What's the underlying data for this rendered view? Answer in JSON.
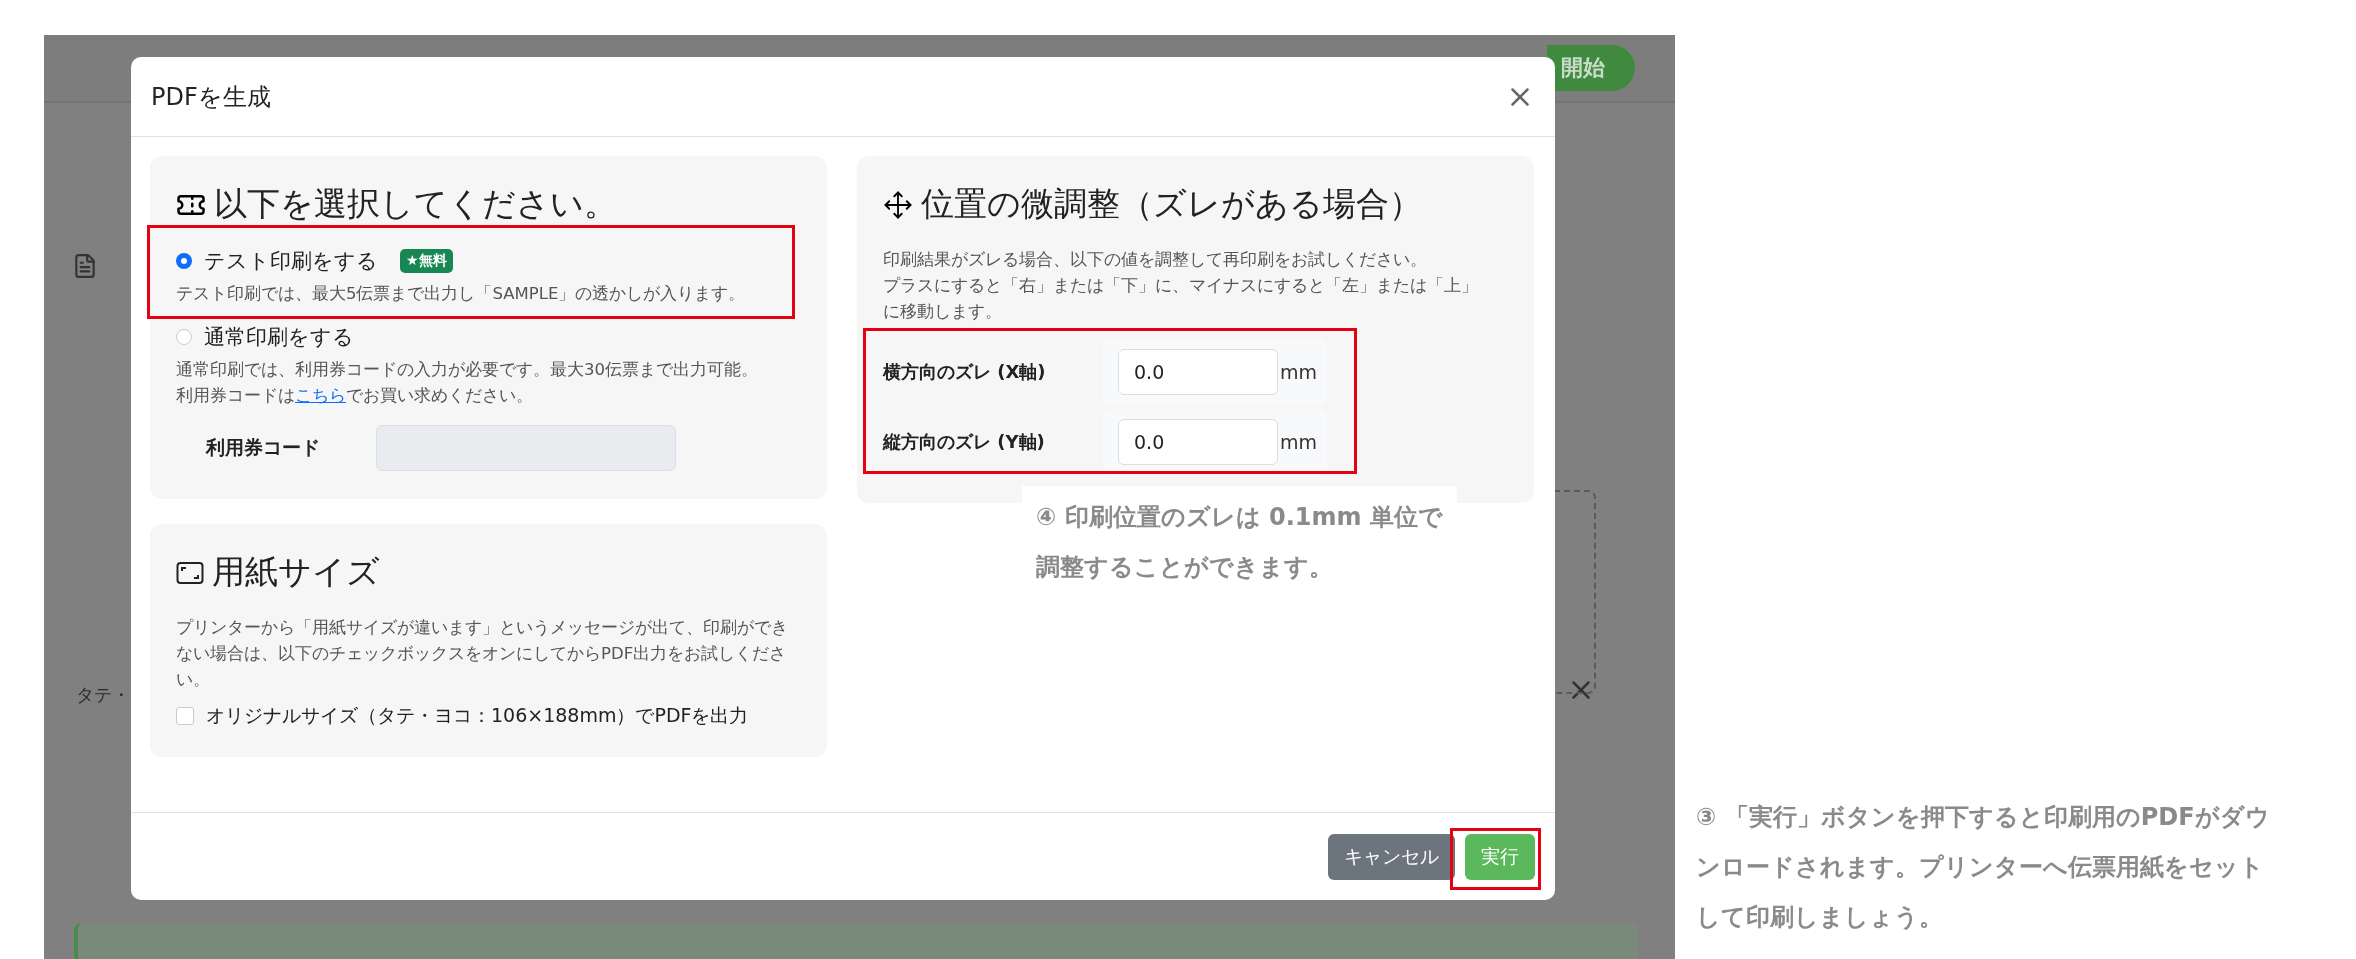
{
  "background_page": {
    "start_button": "開始",
    "side_label": "タテ・"
  },
  "dialog": {
    "title": "PDFを生成",
    "print_mode": {
      "heading": "以下を選択してください。",
      "options": [
        {
          "label": "テスト印刷をする",
          "badge": "★無料",
          "selected": true,
          "description": "テスト印刷では、最大5伝票まで出力し「SAMPLE」の透かしが入ります。"
        },
        {
          "label": "通常印刷をする",
          "selected": false,
          "description": "通常印刷では、利用券コードの入力が必要です。最大30伝票まで出力可能。",
          "note_before": "利用券コードは",
          "note_link": "こちら",
          "note_after": "でお買い求めください。"
        }
      ],
      "coupon": {
        "label": "利用券コード",
        "disabled": true
      }
    },
    "paper_size": {
      "heading": "用紙サイズ",
      "description": "プリンターから「用紙サイズが違います」というメッセージが出て、印刷ができない場合は、以下のチェックボックスをオンにしてからPDF出力をお試しください。",
      "checkbox": {
        "label": "オリジナルサイズ（タテ・ヨコ：106×188mm）でPDFを出力",
        "checked": false
      }
    },
    "offset": {
      "heading": "位置の微調整（ズレがある場合）",
      "description_lines": [
        "印刷結果がズレる場合、以下の値を調整して再印刷をお試しください。",
        "プラスにすると「右」または「下」に、マイナスにすると「左」または「上」",
        "に移動します。"
      ],
      "fields": [
        {
          "label": "横方向のズレ (X軸)",
          "value": "0.0",
          "unit": "mm"
        },
        {
          "label": "縦方向のズレ (Y軸)",
          "value": "0.0",
          "unit": "mm"
        }
      ]
    },
    "buttons": [
      {
        "label": "キャンセル",
        "kind": "secondary"
      },
      {
        "label": "実行",
        "kind": "primary"
      }
    ]
  },
  "annotations": [
    {
      "lines": [
        "④ 印刷位置のズレは 0.1mm 単位で",
        "調整することができます。"
      ]
    },
    {
      "lines": [
        "③ 「実行」ボタンを押下すると印刷用のPDFがダウ",
        "ンロードされます。プリンターへ伝票用紙をセット",
        "して印刷しましょう。"
      ]
    }
  ]
}
